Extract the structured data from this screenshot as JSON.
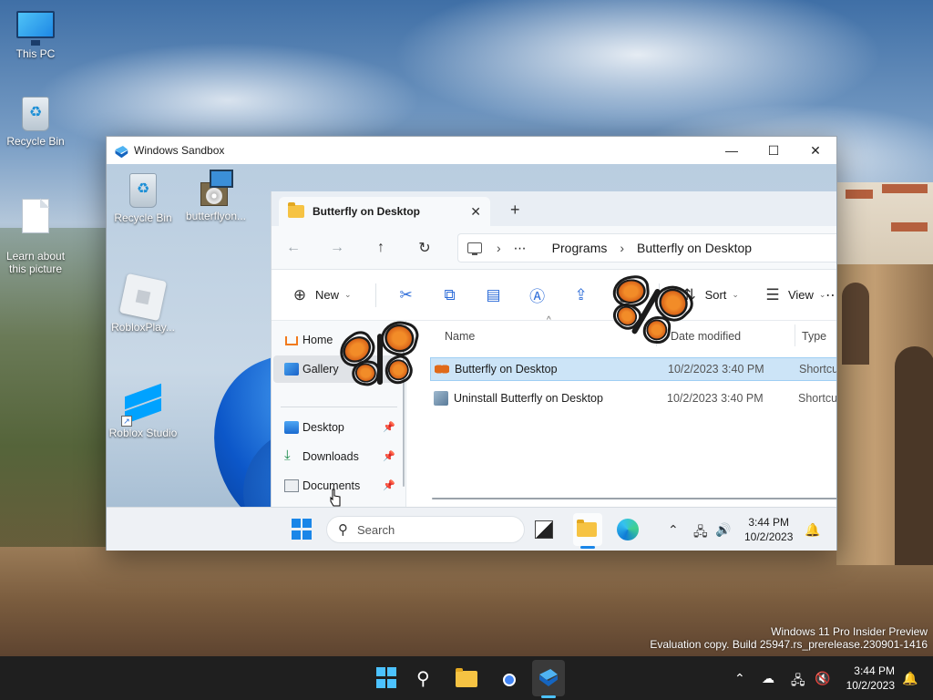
{
  "host": {
    "desktop_icons": [
      {
        "label": "This PC",
        "icon": "monitor-icon"
      },
      {
        "label": "Recycle Bin",
        "icon": "recycle-bin-icon"
      },
      {
        "label": "Learn about\nthis picture",
        "icon": "document-icon"
      }
    ],
    "watermark": {
      "line1": "Windows 11 Pro Insider Preview",
      "line2": "Evaluation copy. Build 25947.rs_prerelease.230901-1416"
    },
    "taskbar": {
      "apps": [
        "start-icon",
        "search-icon",
        "file-explorer-icon",
        "chrome-icon",
        "windows-sandbox-icon"
      ],
      "active_app": "windows-sandbox-icon",
      "tray_icons": [
        "chevron-up-icon",
        "onedrive-cloud-icon",
        "network-icon",
        "volume-muted-icon",
        "notification-bell-icon"
      ],
      "time": "3:44 PM",
      "date": "10/2/2023"
    }
  },
  "sandbox": {
    "title": "Windows Sandbox",
    "controls": {
      "minimize": "—",
      "maximize": "☐",
      "close": "✕"
    },
    "desktop_icons": [
      {
        "label": "Recycle Bin"
      },
      {
        "label": "butterflyon..."
      },
      {
        "label": "RobloxPlay..."
      },
      {
        "label": "Roblox Studio"
      }
    ],
    "explorer": {
      "tab_title": "Butterfly on Desktop",
      "tab_close": "✕",
      "new_tab": "+",
      "breadcrumb": [
        "⋯",
        "Programs",
        "Butterfly on Desktop"
      ],
      "commands": {
        "new": "New",
        "sort": "Sort",
        "view": "View",
        "more": "⋯"
      },
      "nav": [
        {
          "label": "Home",
          "icon": "home-icon",
          "pinned": false
        },
        {
          "label": "Gallery",
          "icon": "gallery-icon",
          "pinned": false,
          "selected": true
        },
        {
          "label": "Desktop",
          "icon": "desktop-folder-icon",
          "pinned": true
        },
        {
          "label": "Downloads",
          "icon": "download-arrow-icon",
          "pinned": true
        },
        {
          "label": "Documents",
          "icon": "documents-folder-icon",
          "pinned": true
        }
      ],
      "columns": {
        "name": "Name",
        "date": "Date modified",
        "type": "Type"
      },
      "files": [
        {
          "name": "Butterfly on Desktop",
          "date": "10/2/2023 3:40 PM",
          "type": "Shortcut",
          "selected": true
        },
        {
          "name": "Uninstall Butterfly on Desktop",
          "date": "10/2/2023 3:40 PM",
          "type": "Shortcut",
          "selected": false
        }
      ]
    },
    "taskbar": {
      "search_placeholder": "Search",
      "time": "3:44 PM",
      "date": "10/2/2023"
    }
  },
  "colors": {
    "accent": "#1a86e8",
    "selection": "#cce4f7",
    "butterfly": "#f28c28",
    "host_taskbar": "#1f1f1f"
  }
}
